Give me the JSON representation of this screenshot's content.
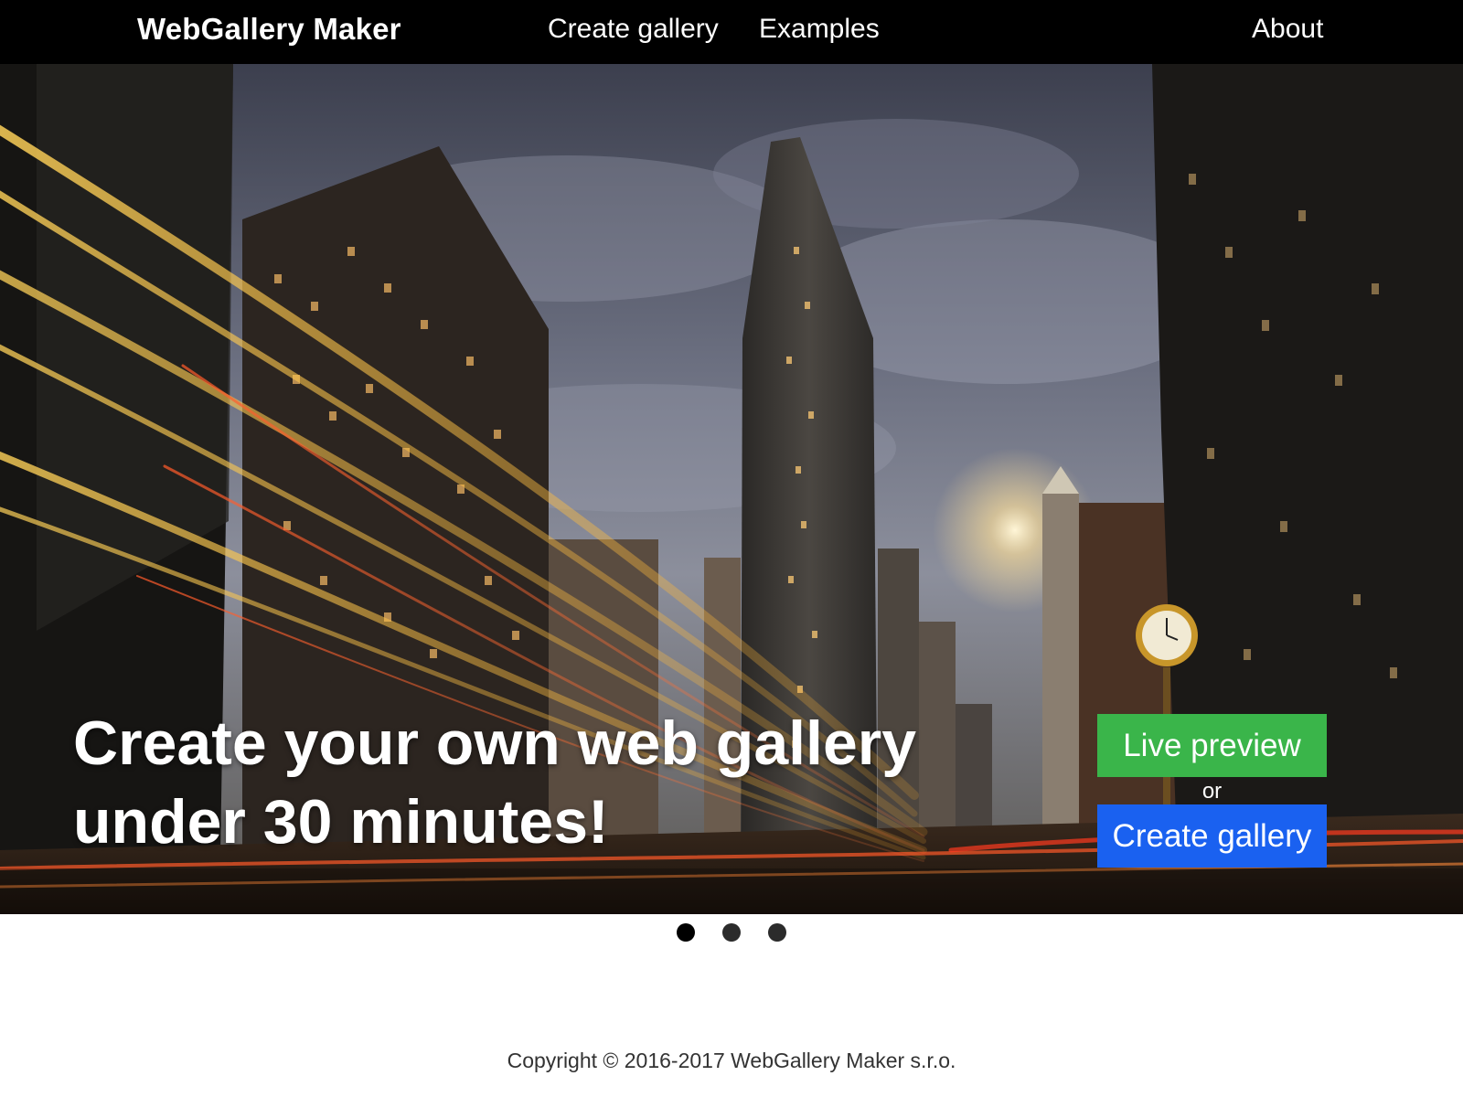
{
  "nav": {
    "brand": "WebGallery Maker",
    "links": [
      {
        "label": "Create gallery"
      },
      {
        "label": "Examples"
      },
      {
        "label": "About"
      }
    ]
  },
  "hero": {
    "headline_line1": "Create your own web gallery",
    "headline_line2": "under 30 minutes!",
    "live_preview_label": "Live preview",
    "or_label": "or",
    "create_gallery_label": "Create gallery",
    "background_image": "night city street with Flatiron building and light trails",
    "colors": {
      "live_preview_bg": "#3ab54a",
      "create_gallery_bg": "#1a61f0"
    }
  },
  "slider": {
    "slide_count": 3,
    "active_slide": 1
  },
  "footer": {
    "copyright": "Copyright © 2016-2017 WebGallery Maker s.r.o."
  },
  "colors": {
    "navbar_bg": "#000000",
    "nav_text": "#ffffff",
    "footer_text": "#333333"
  }
}
